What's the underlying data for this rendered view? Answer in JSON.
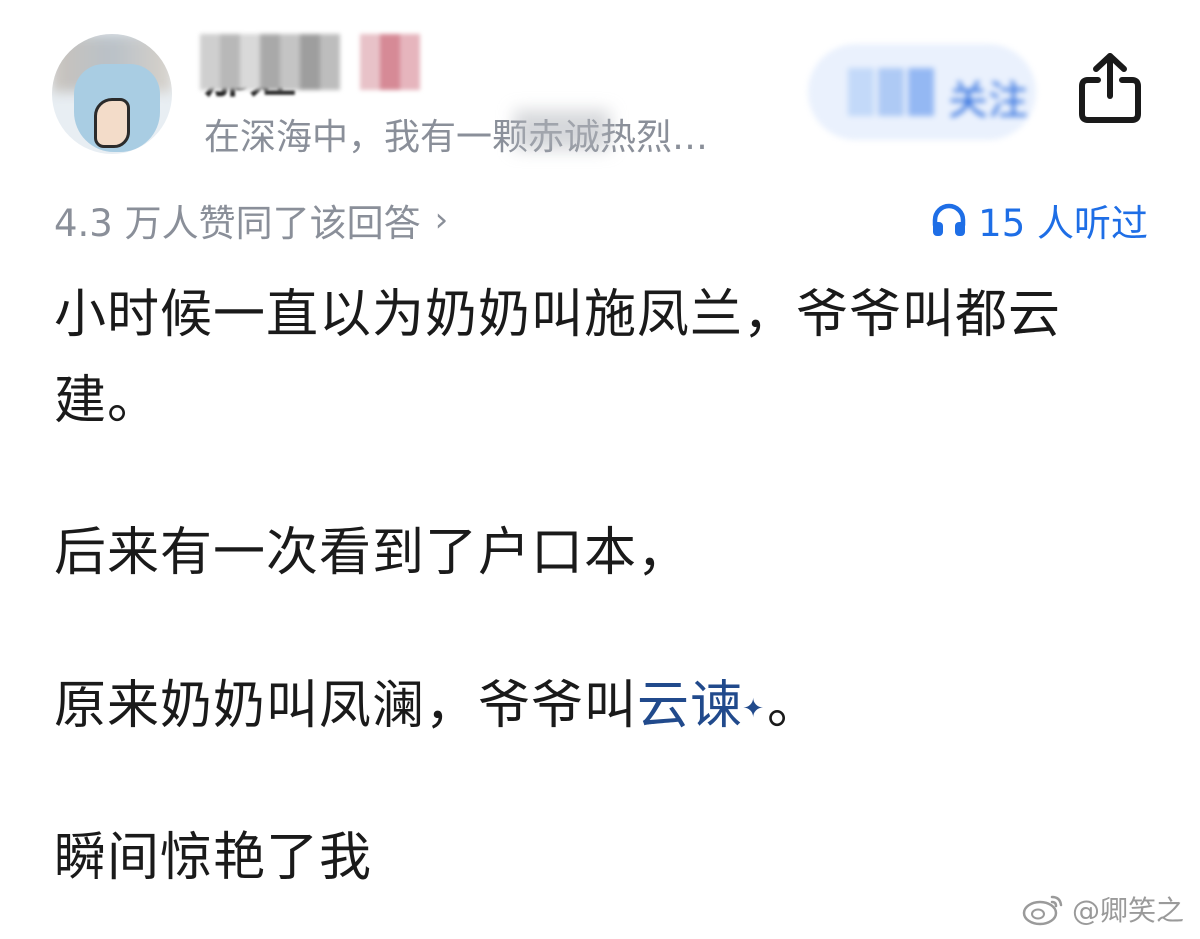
{
  "author": {
    "name": "那娃",
    "bio": "在深海中，我有一颗赤诚热烈…",
    "follow_label": "关注"
  },
  "meta": {
    "upvotes_text": "4.3 万人赞同了该回答",
    "chevron": "›",
    "listen_text": "15 人听过"
  },
  "answer": {
    "paragraph_1": "小时候一直以为奶奶叫施凤兰，爷爷叫都云建。",
    "paragraph_2": "后来有一次看到了户口本，",
    "paragraph_3_prefix": "原来奶奶叫凤澜，爷爷叫",
    "paragraph_3_link": "云谏",
    "paragraph_3_suffix": "。",
    "paragraph_4": "瞬间惊艳了我",
    "link_sparkle": "✦"
  },
  "watermark": {
    "text": "@卿笑之",
    "icon": "weibo-icon"
  },
  "colors": {
    "accent_blue": "#1e6ee6",
    "link_blue": "#214a8c",
    "muted_gray": "#8a8f99",
    "body_text": "#1a1a1a"
  }
}
